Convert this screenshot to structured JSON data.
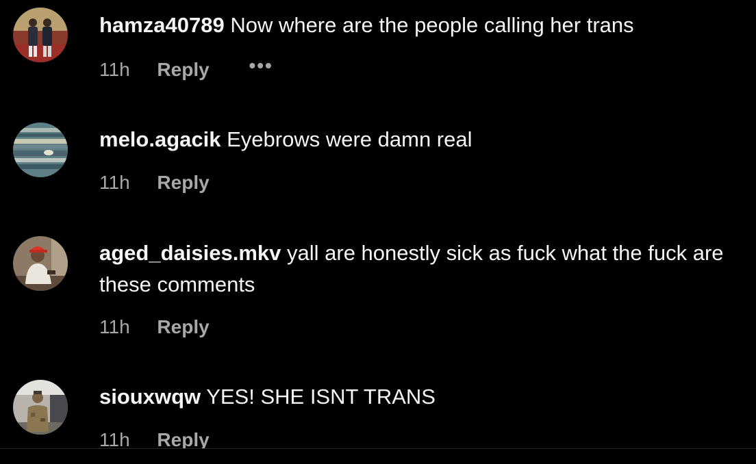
{
  "comments": [
    {
      "username": "hamza40789",
      "text": "Now where are the people calling her trans",
      "time": "11h",
      "reply_label": "Reply",
      "more_label": "•••",
      "avatar": "two-men-standing-photo"
    },
    {
      "username": "melo.agacik",
      "text": "Eyebrows were damn real",
      "time": "11h",
      "reply_label": "Reply",
      "avatar": "jupiter-planet-photo"
    },
    {
      "username": "aged_daisies.mkv",
      "text": "yall are honestly sick as fuck what the fuck are these comments",
      "time": "11h",
      "reply_label": "Reply",
      "avatar": "man-in-red-cap-photo"
    },
    {
      "username": "siouxwqw",
      "text": "YES! SHE ISNT TRANS",
      "time": "11h",
      "reply_label": "Reply",
      "avatar": "soldier-in-camo-photo"
    }
  ],
  "colors": {
    "background": "#000000",
    "primary_text": "#f5f5f5",
    "secondary_text": "#a8a8a8"
  }
}
